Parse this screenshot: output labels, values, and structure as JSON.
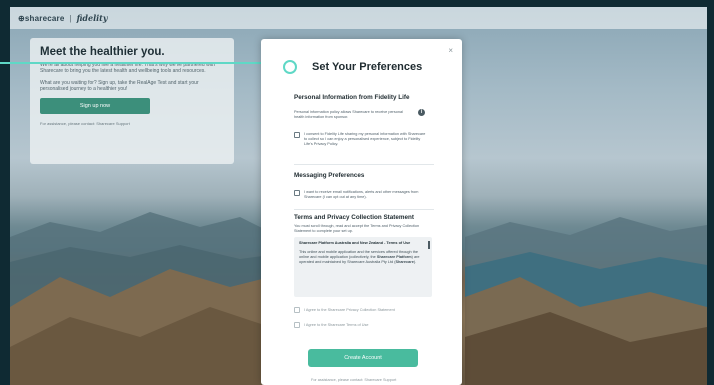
{
  "topbar": {
    "brand": "sharecare",
    "brand_prefix": "⊕",
    "separator": "|",
    "partner": "fidelity"
  },
  "promo": {
    "title": "Meet the healthier you.",
    "para1": "We're all about helping you live a healthier life. That's why we've partnered with Sharecare to bring you the latest health and wellbeing tools and resources.",
    "para2": "What are you waiting for? Sign up, take the RealAge Test and start your personalised journey to a healthier you!",
    "signup_label": "Sign up now",
    "assist": "For assistance, please contact: Sharecare Support"
  },
  "modal": {
    "close": "×",
    "title": "Set Your Preferences",
    "personal": {
      "heading": "Personal Information from Fidelity Life",
      "policy": "Personal information policy allows Sharecare to receive personal health information from sponsor.",
      "info_icon": "i",
      "consent": "I consent to Fidelity Life sharing my personal information with Sharecare to collect so I can enjoy a personalised experience, subject to Fidelity Life's Privacy Policy."
    },
    "messaging": {
      "heading": "Messaging Preferences",
      "consent": "I want to receive email notifications, alerts and other messages from Sharecare (I can opt out at any time)."
    },
    "terms": {
      "heading": "Terms and Privacy Collection Statement",
      "instructions": "You must scroll through, read and accept the Terms and Privacy Collection Statement to complete your set up.",
      "box_heading": "Sharecare Platform Australia and New Zealand - Terms of Use",
      "box_text_1": "This online and mobile application and the services offered through the online and mobile application (collectively, the ",
      "box_bold_1": "Sharecare Platform",
      "box_text_2": ") are operated and maintained by Sharecare Australia Pty Ltd (",
      "box_bold_2": "Sharecare",
      "box_text_3": ").",
      "agree_privacy": "I Agree to the Sharecare Privacy Collection Statement",
      "agree_terms": "I Agree to the Sharecare Terms of Use"
    },
    "create_label": "Create Account",
    "footer": "For assistance, please contact: Sharecare Support"
  },
  "colors": {
    "accent": "#49bb9e",
    "connector": "#5fd8c6",
    "signup": "#3c8f7b"
  }
}
